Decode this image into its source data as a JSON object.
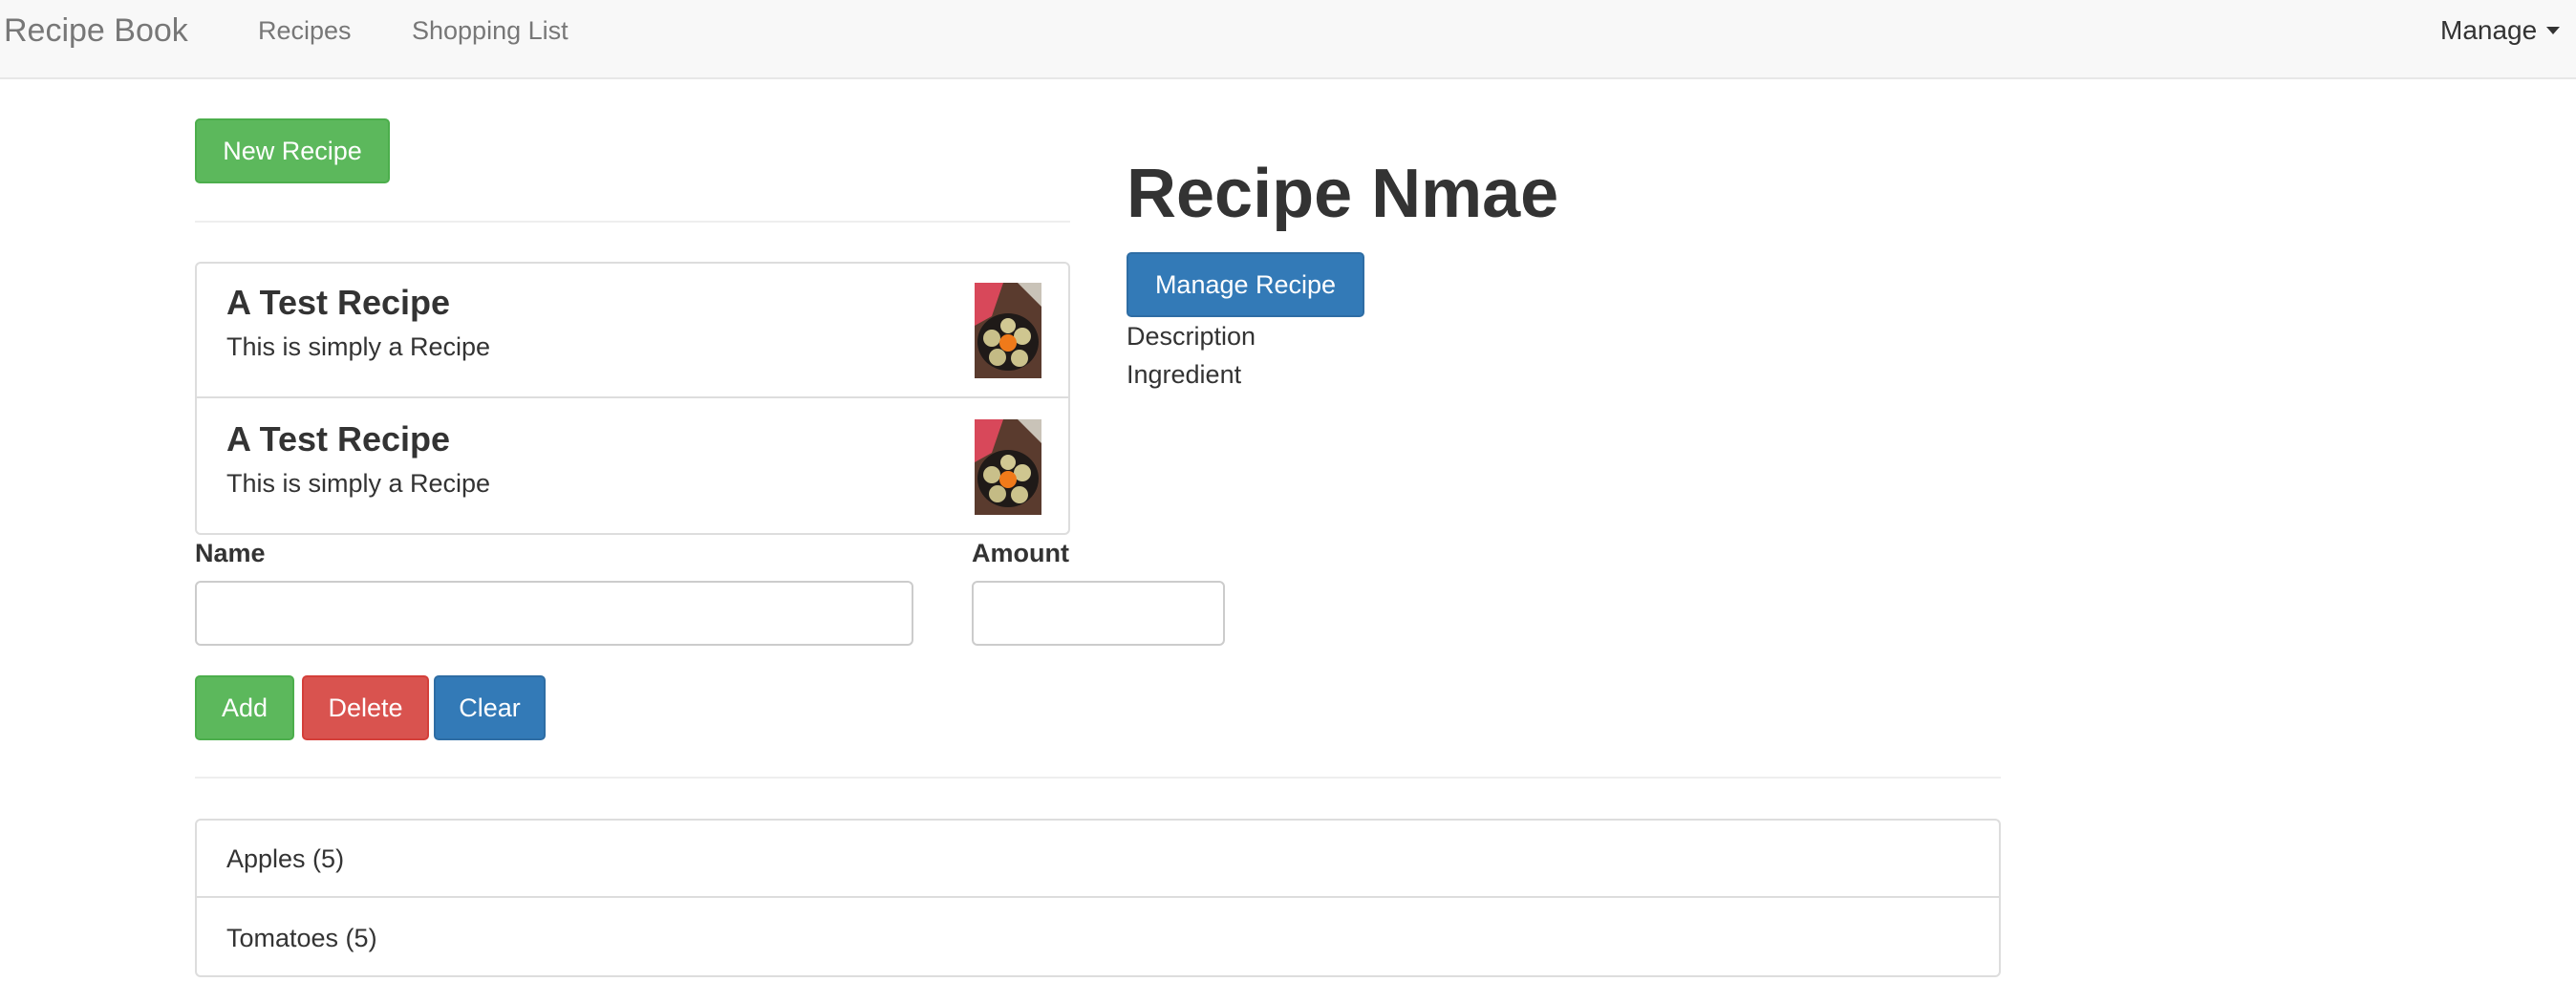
{
  "navbar": {
    "brand": "Recipe Book",
    "links": [
      {
        "label": "Recipes"
      },
      {
        "label": "Shopping List"
      }
    ],
    "manage_label": "Manage"
  },
  "recipes": {
    "new_button_label": "New Recipe",
    "items": [
      {
        "title": "A Test Recipe",
        "description": "This is simply a Recipe",
        "image": "recipe-photo"
      },
      {
        "title": "A Test Recipe",
        "description": "This is simply a Recipe",
        "image": "recipe-photo"
      }
    ]
  },
  "detail": {
    "name": "Recipe Nmae",
    "manage_button_label": "Manage Recipe",
    "description_label": "Description",
    "ingredient_label": "Ingredient"
  },
  "shopping_form": {
    "name_label": "Name",
    "amount_label": "Amount",
    "name_value": "",
    "amount_value": "",
    "add_label": "Add",
    "delete_label": "Delete",
    "clear_label": "Clear"
  },
  "shopping_list": {
    "items": [
      {
        "text": "Apples (5)"
      },
      {
        "text": "Tomatoes (5)"
      }
    ]
  },
  "colors": {
    "success": "#5cb85c",
    "danger": "#d9534f",
    "primary": "#337ab7",
    "navbar_bg": "#f8f8f8"
  }
}
